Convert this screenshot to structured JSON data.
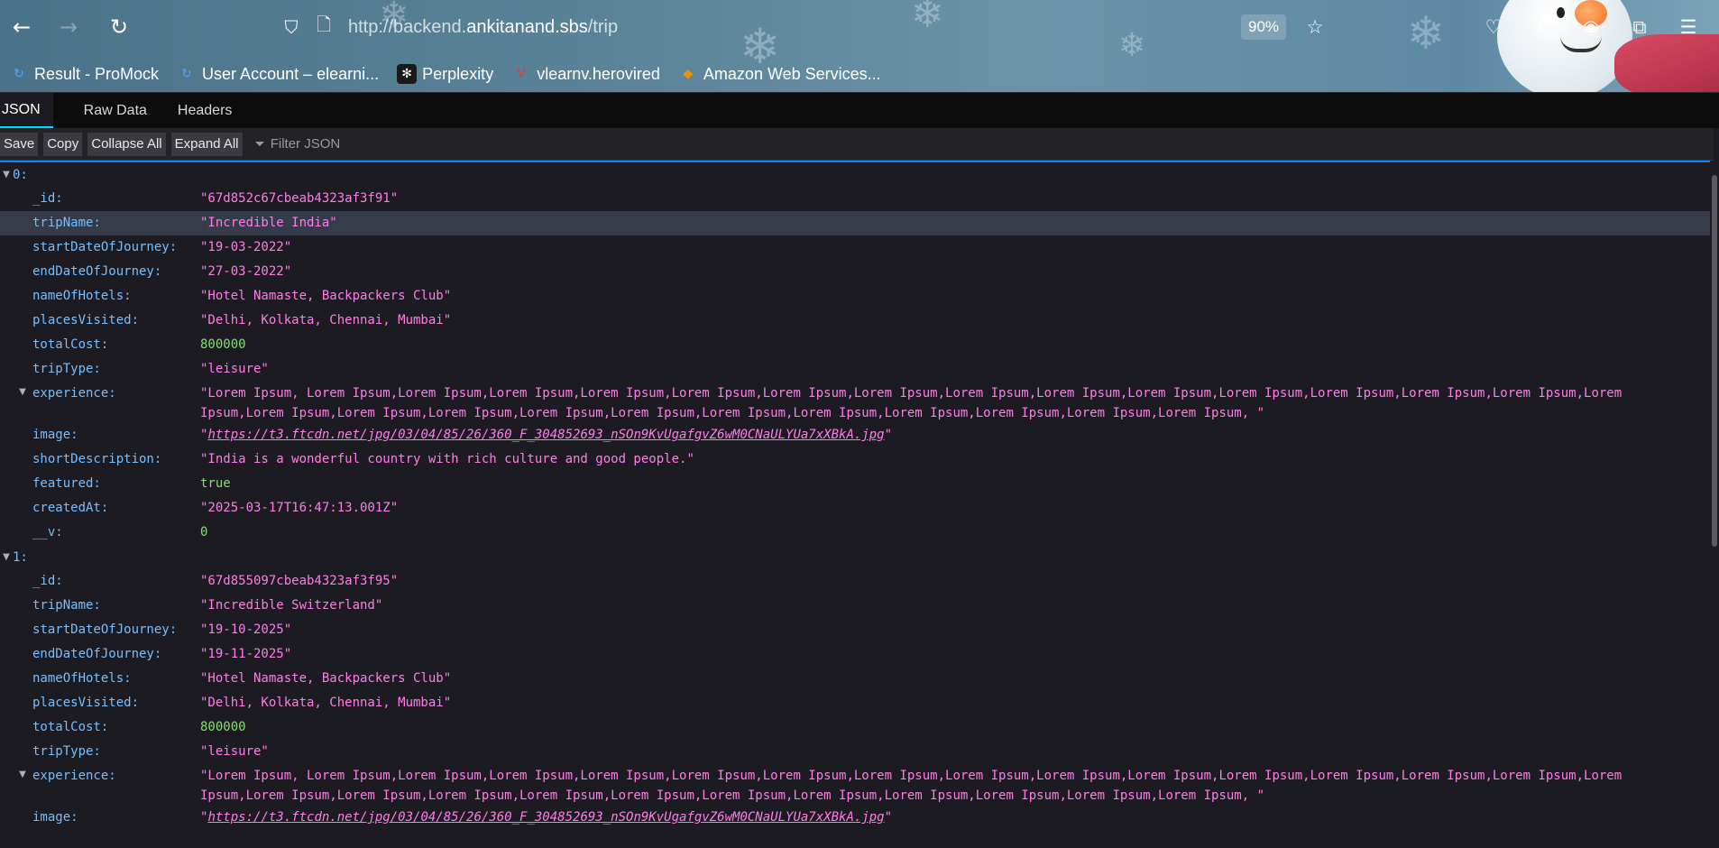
{
  "browser": {
    "url_prefix": "http://backend.",
    "url_domain": "ankitanand.sbs",
    "url_path": "/trip",
    "zoom": "90%"
  },
  "bookmarks": [
    {
      "label": "Result - ProMock",
      "icon": "refresh-c-icon",
      "color": "#4aa8ff"
    },
    {
      "label": "User Account – elearni...",
      "icon": "refresh-c-icon",
      "color": "#4aa8ff"
    },
    {
      "label": "Perplexity",
      "icon": "perplexity-icon",
      "color": "#1a1a1a"
    },
    {
      "label": "vlearnv.herovired",
      "icon": "herovired-icon",
      "color": "#e8383d"
    },
    {
      "label": "Amazon Web Services...",
      "icon": "aws-cube-icon",
      "color": "#f29100"
    }
  ],
  "viewer": {
    "tabs": [
      "JSON",
      "Raw Data",
      "Headers"
    ],
    "toolbar": {
      "save": "Save",
      "copy": "Copy",
      "collapse": "Collapse All",
      "expand": "Expand All"
    },
    "filter_placeholder": "Filter JSON"
  },
  "records": [
    {
      "index": "0:",
      "fields": [
        {
          "key": "_id:",
          "value": "\"67d852c67cbeab4323af3f91\"",
          "type": "str"
        },
        {
          "key": "tripName:",
          "value": "\"Incredible India\"",
          "type": "str",
          "selected": true
        },
        {
          "key": "startDateOfJourney:",
          "value": "\"19-03-2022\"",
          "type": "str"
        },
        {
          "key": "endDateOfJourney:",
          "value": "\"27-03-2022\"",
          "type": "str"
        },
        {
          "key": "nameOfHotels:",
          "value": "\"Hotel Namaste, Backpackers Club\"",
          "type": "str"
        },
        {
          "key": "placesVisited:",
          "value": "\"Delhi, Kolkata, Chennai, Mumbai\"",
          "type": "str"
        },
        {
          "key": "totalCost:",
          "value": "800000",
          "type": "num"
        },
        {
          "key": "tripType:",
          "value": "\"leisure\"",
          "type": "str"
        },
        {
          "key": "experience:",
          "value": "\"Lorem Ipsum, Lorem Ipsum,Lorem Ipsum,Lorem Ipsum,Lorem Ipsum,Lorem Ipsum,Lorem Ipsum,Lorem Ipsum,Lorem Ipsum,Lorem Ipsum,Lorem Ipsum,Lorem Ipsum,Lorem Ipsum,Lorem Ipsum,Lorem Ipsum,Lorem Ipsum,Lorem Ipsum,Lorem Ipsum,Lorem Ipsum,Lorem Ipsum,Lorem Ipsum,Lorem Ipsum,Lorem Ipsum,Lorem Ipsum,Lorem Ipsum,Lorem Ipsum,Lorem Ipsum, \"",
          "type": "str",
          "expandable": true
        },
        {
          "key": "image:",
          "value": "https://t3.ftcdn.net/jpg/03/04/85/26/360_F_304852693_nSOn9KvUgafgvZ6wM0CNaULYUa7xXBkA.jpg",
          "type": "url"
        },
        {
          "key": "shortDescription:",
          "value": "\"India is a wonderful country with rich culture and good people.\"",
          "type": "str"
        },
        {
          "key": "featured:",
          "value": "true",
          "type": "bool"
        },
        {
          "key": "createdAt:",
          "value": "\"2025-03-17T16:47:13.001Z\"",
          "type": "str"
        },
        {
          "key": "__v:",
          "value": "0",
          "type": "num"
        }
      ]
    },
    {
      "index": "1:",
      "fields": [
        {
          "key": "_id:",
          "value": "\"67d855097cbeab4323af3f95\"",
          "type": "str"
        },
        {
          "key": "tripName:",
          "value": "\"Incredible Switzerland\"",
          "type": "str"
        },
        {
          "key": "startDateOfJourney:",
          "value": "\"19-10-2025\"",
          "type": "str"
        },
        {
          "key": "endDateOfJourney:",
          "value": "\"19-11-2025\"",
          "type": "str"
        },
        {
          "key": "nameOfHotels:",
          "value": "\"Hotel Namaste, Backpackers Club\"",
          "type": "str"
        },
        {
          "key": "placesVisited:",
          "value": "\"Delhi, Kolkata, Chennai, Mumbai\"",
          "type": "str"
        },
        {
          "key": "totalCost:",
          "value": "800000",
          "type": "num"
        },
        {
          "key": "tripType:",
          "value": "\"leisure\"",
          "type": "str"
        },
        {
          "key": "experience:",
          "value": "\"Lorem Ipsum, Lorem Ipsum,Lorem Ipsum,Lorem Ipsum,Lorem Ipsum,Lorem Ipsum,Lorem Ipsum,Lorem Ipsum,Lorem Ipsum,Lorem Ipsum,Lorem Ipsum,Lorem Ipsum,Lorem Ipsum,Lorem Ipsum,Lorem Ipsum,Lorem Ipsum,Lorem Ipsum,Lorem Ipsum,Lorem Ipsum,Lorem Ipsum,Lorem Ipsum,Lorem Ipsum,Lorem Ipsum,Lorem Ipsum,Lorem Ipsum,Lorem Ipsum,Lorem Ipsum, \"",
          "type": "str",
          "expandable": true
        },
        {
          "key": "image:",
          "value": "https://t3.ftcdn.net/jpg/03/04/85/26/360_F_304852693_nSOn9KvUgafgvZ6wM0CNaULYUa7xXBkA.jpg",
          "type": "url"
        }
      ]
    }
  ]
}
